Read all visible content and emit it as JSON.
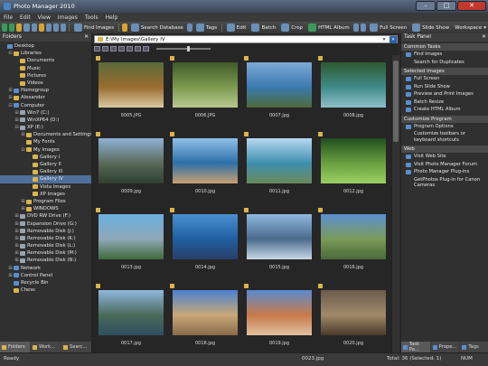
{
  "app": {
    "title": "Photo Manager 2010"
  },
  "menu": [
    "File",
    "Edit",
    "View",
    "Images",
    "Tools",
    "Help"
  ],
  "toolbar": {
    "find_images": "Find Images",
    "search_database": "Search Database",
    "tags": "Tags",
    "edit": "Edit",
    "batch": "Batch",
    "crop": "Crop",
    "html_album": "HTML Album",
    "full_screen": "Full Screen",
    "slide_show": "Slide Show",
    "workspace": "Workspace"
  },
  "folders_panel": {
    "title": "Folders",
    "tree": [
      {
        "label": "Desktop",
        "indent": 0,
        "expander": "",
        "icon": "blue"
      },
      {
        "label": "Libraries",
        "indent": 1,
        "expander": "⊟",
        "icon": "folder"
      },
      {
        "label": "Documents",
        "indent": 2,
        "expander": "",
        "icon": "folder"
      },
      {
        "label": "Music",
        "indent": 2,
        "expander": "",
        "icon": "folder"
      },
      {
        "label": "Pictures",
        "indent": 2,
        "expander": "",
        "icon": "folder"
      },
      {
        "label": "Videos",
        "indent": 2,
        "expander": "",
        "icon": "folder"
      },
      {
        "label": "Homegroup",
        "indent": 1,
        "expander": "⊞",
        "icon": "blue"
      },
      {
        "label": "Alexander",
        "indent": 1,
        "expander": "⊞",
        "icon": "folder"
      },
      {
        "label": "Computer",
        "indent": 1,
        "expander": "⊟",
        "icon": "blue"
      },
      {
        "label": "Win7 (C:)",
        "indent": 2,
        "expander": "⊞",
        "icon": "drive"
      },
      {
        "label": "WinXP64 (D:)",
        "indent": 2,
        "expander": "⊞",
        "icon": "drive"
      },
      {
        "label": "XP (E:)",
        "indent": 2,
        "expander": "⊟",
        "icon": "drive"
      },
      {
        "label": "Documents and Settings",
        "indent": 3,
        "expander": "⊞",
        "icon": "folder"
      },
      {
        "label": "My Fonts",
        "indent": 3,
        "expander": "",
        "icon": "folder"
      },
      {
        "label": "My Images",
        "indent": 3,
        "expander": "⊟",
        "icon": "folder"
      },
      {
        "label": "Gallery I",
        "indent": 4,
        "expander": "",
        "icon": "folder"
      },
      {
        "label": "Gallery II",
        "indent": 4,
        "expander": "",
        "icon": "folder"
      },
      {
        "label": "Gallery III",
        "indent": 4,
        "expander": "",
        "icon": "folder"
      },
      {
        "label": "Gallery IV",
        "indent": 4,
        "expander": "",
        "icon": "folder",
        "selected": true
      },
      {
        "label": "Vista Images",
        "indent": 4,
        "expander": "",
        "icon": "folder"
      },
      {
        "label": "XP Images",
        "indent": 4,
        "expander": "",
        "icon": "folder"
      },
      {
        "label": "Program Files",
        "indent": 3,
        "expander": "⊞",
        "icon": "folder"
      },
      {
        "label": "WINDOWS",
        "indent": 3,
        "expander": "⊞",
        "icon": "folder"
      },
      {
        "label": "DVD RW Drive (F:)",
        "indent": 2,
        "expander": "⊞",
        "icon": "drive"
      },
      {
        "label": "Expansion Drive (G:)",
        "indent": 2,
        "expander": "⊞",
        "icon": "drive"
      },
      {
        "label": "Removable Disk (J:)",
        "indent": 2,
        "expander": "⊞",
        "icon": "drive"
      },
      {
        "label": "Removable Disk (K:)",
        "indent": 2,
        "expander": "⊞",
        "icon": "drive"
      },
      {
        "label": "Removable Disk (L:)",
        "indent": 2,
        "expander": "⊞",
        "icon": "drive"
      },
      {
        "label": "Removable Disk (M:)",
        "indent": 2,
        "expander": "⊞",
        "icon": "drive"
      },
      {
        "label": "Removable Disk (N:)",
        "indent": 2,
        "expander": "⊞",
        "icon": "drive"
      },
      {
        "label": "Network",
        "indent": 1,
        "expander": "⊞",
        "icon": "blue"
      },
      {
        "label": "Control Panel",
        "indent": 1,
        "expander": "⊞",
        "icon": "blue"
      },
      {
        "label": "Recycle Bin",
        "indent": 1,
        "expander": "",
        "icon": "blue"
      },
      {
        "label": "Chess",
        "indent": 1,
        "expander": "",
        "icon": "folder"
      }
    ],
    "tabs": [
      "Folders",
      "Work...",
      "Searc..."
    ]
  },
  "address": {
    "path": "E:\\My Images\\Gallery IV"
  },
  "thumbnails": [
    {
      "name": "0005.JPG",
      "colors": [
        "#5b6b3a",
        "#9a6b2e",
        "#d9c9a0"
      ]
    },
    {
      "name": "0006.JPG",
      "colors": [
        "#3f5a28",
        "#7d9a50",
        "#b7c98f"
      ]
    },
    {
      "name": "0007.jpg",
      "colors": [
        "#7ea9d6",
        "#3a7ab0",
        "#4e6a3a"
      ]
    },
    {
      "name": "0008.jpg",
      "colors": [
        "#2e5a2e",
        "#3f8a8a",
        "#8fc0c8"
      ]
    },
    {
      "name": "0009.jpg",
      "colors": [
        "#8fb1d6",
        "#5a6a5a",
        "#2f3f2f"
      ]
    },
    {
      "name": "0010.jpg",
      "colors": [
        "#8fc0e8",
        "#2e6fa8",
        "#c8a070"
      ]
    },
    {
      "name": "0011.jpg",
      "colors": [
        "#b8d8f0",
        "#3f8fb0",
        "#6a8a5a"
      ]
    },
    {
      "name": "0012.jpg",
      "colors": [
        "#1f4f1f",
        "#6aa040",
        "#9ad060"
      ]
    },
    {
      "name": "0013.jpg",
      "colors": [
        "#6ab0e0",
        "#8fa8b8",
        "#3f6a3a"
      ]
    },
    {
      "name": "0014.jpg",
      "colors": [
        "#4a90d0",
        "#1f5fa0",
        "#2a3f6a"
      ]
    },
    {
      "name": "0015.jpg",
      "colors": [
        "#8fb8e0",
        "#4a6a8a",
        "#c8d8e8"
      ]
    },
    {
      "name": "0016.jpg",
      "colors": [
        "#5a90d0",
        "#7a9a5a",
        "#4a6a3a"
      ]
    },
    {
      "name": "0017.jpg",
      "colors": [
        "#8fb8e0",
        "#4a6a5a",
        "#2f4f5f"
      ]
    },
    {
      "name": "0018.jpg",
      "colors": [
        "#4a80d0",
        "#c8a878",
        "#8a6a4a"
      ]
    },
    {
      "name": "0019.jpg",
      "colors": [
        "#5a8ad0",
        "#c87a4a",
        "#e0c0a0"
      ]
    },
    {
      "name": "0020.jpg",
      "colors": [
        "#6a5a4a",
        "#a08a6a",
        "#4a3a2a"
      ]
    }
  ],
  "task_panel": {
    "title": "Task Panel",
    "sections": [
      {
        "title": "Common Tasks",
        "items": [
          {
            "label": "Find Images",
            "icon": true
          },
          {
            "label": "Search for Duplicates",
            "icon": false
          }
        ]
      },
      {
        "title": "Selected Images",
        "items": [
          {
            "label": "Full Screen",
            "icon": true
          },
          {
            "label": "Run Slide Show",
            "icon": true
          },
          {
            "label": "Preview and Print Images",
            "icon": true
          },
          {
            "label": "Batch Resize",
            "icon": true
          },
          {
            "label": "Create HTML Album",
            "icon": true
          }
        ]
      },
      {
        "title": "Customize Program",
        "items": [
          {
            "label": "Program Options",
            "icon": true
          },
          {
            "label": "Customize toolbars or keyboard shortcuts",
            "icon": false
          }
        ]
      },
      {
        "title": "Web",
        "items": [
          {
            "label": "Visit Web Site",
            "icon": true
          },
          {
            "label": "Visit Photo Manager Forum",
            "icon": true
          },
          {
            "label": "Photo Manager Plug-ins",
            "icon": true
          },
          {
            "label": "GetPhotos Plug-in for Canon Cameras",
            "icon": false
          }
        ]
      }
    ],
    "tabs": [
      "Task Pa...",
      "Prope...",
      "Tags"
    ]
  },
  "status": {
    "left": "Ready",
    "file": "0023.jpg",
    "total": "Total: 36 (Selected: 1)",
    "num": "NUM"
  }
}
